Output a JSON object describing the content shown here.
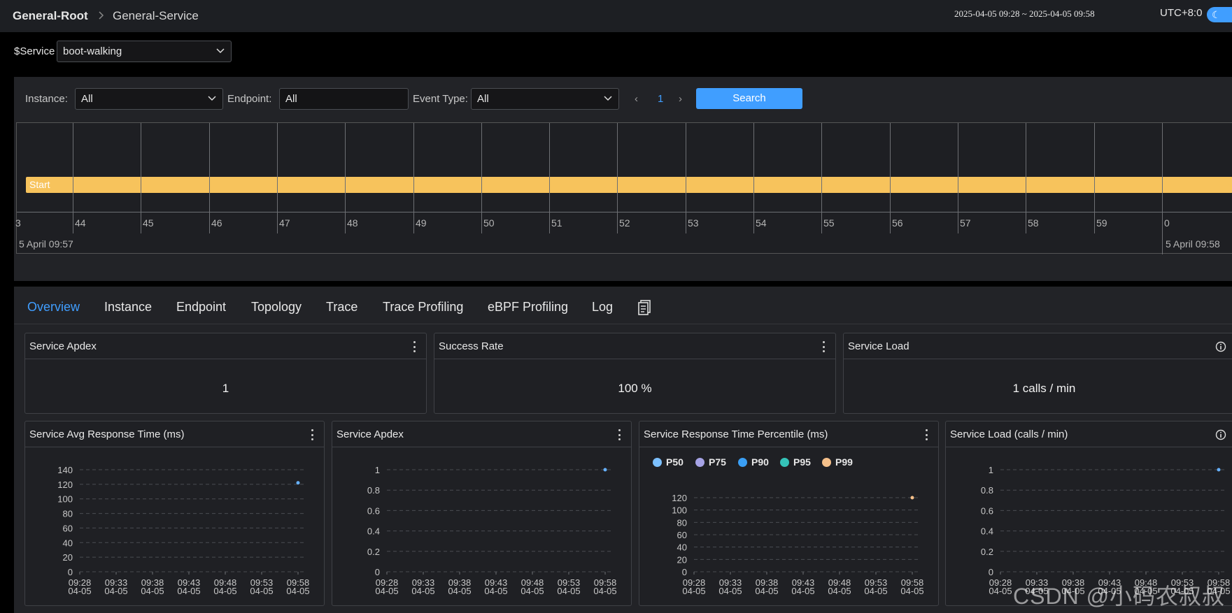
{
  "header": {
    "root_crumb": "General-Root",
    "page_crumb": "General-Service",
    "time_range": "2025-04-05 09:28 ~ 2025-04-05 09:58",
    "timezone": "UTC+8:0"
  },
  "service_selector": {
    "label": "$Service",
    "value": "boot-walking"
  },
  "events_filter": {
    "instance_label": "Instance:",
    "instance_value": "All",
    "endpoint_label": "Endpoint:",
    "endpoint_value": "All",
    "event_type_label": "Event Type:",
    "event_type_value": "All",
    "prev": "‹",
    "page": "1",
    "next": "›",
    "search_label": "Search"
  },
  "timeline": {
    "event_label": "Start",
    "first_tick_partial": "3",
    "ticks": [
      "44",
      "45",
      "46",
      "47",
      "48",
      "49",
      "50",
      "51",
      "52",
      "53",
      "54",
      "55",
      "56",
      "57",
      "58",
      "59",
      "0"
    ],
    "start_date": "5 April 09:57",
    "end_date": "5 April 09:58"
  },
  "tabs": [
    "Overview",
    "Instance",
    "Endpoint",
    "Topology",
    "Trace",
    "Trace Profiling",
    "eBPF Profiling",
    "Log"
  ],
  "active_tab": "Overview",
  "cards": [
    {
      "title": "Service Apdex",
      "value": "1"
    },
    {
      "title": "Success Rate",
      "value": "100 %"
    },
    {
      "title": "Service Load",
      "value": "1 calls / min"
    }
  ],
  "chart_data": [
    {
      "type": "line",
      "title": "Service Avg Response Time (ms)",
      "x": [
        "09:28\n04-05",
        "09:33\n04-05",
        "09:38\n04-05",
        "09:43\n04-05",
        "09:48\n04-05",
        "09:53\n04-05",
        "09:58\n04-05"
      ],
      "yticks": [
        "0",
        "20",
        "40",
        "60",
        "80",
        "100",
        "120",
        "140"
      ],
      "ylim": [
        0,
        140
      ],
      "series": [
        {
          "points": [
            [
              6,
              122
            ]
          ],
          "color": "#66b1ff"
        }
      ]
    },
    {
      "type": "line",
      "title": "Service Apdex",
      "x": [
        "09:28\n04-05",
        "09:33\n04-05",
        "09:38\n04-05",
        "09:43\n04-05",
        "09:48\n04-05",
        "09:53\n04-05",
        "09:58\n04-05"
      ],
      "yticks": [
        "0",
        "0.2",
        "0.4",
        "0.6",
        "0.8",
        "1"
      ],
      "ylim": [
        0,
        1
      ],
      "series": [
        {
          "points": [
            [
              6,
              1
            ]
          ],
          "color": "#66b1ff"
        }
      ]
    },
    {
      "type": "line",
      "title": "Service Response Time Percentile (ms)",
      "legend": [
        {
          "name": "P50",
          "color": "#7cc0ff"
        },
        {
          "name": "P75",
          "color": "#a6a3e6"
        },
        {
          "name": "P90",
          "color": "#3a9ff5"
        },
        {
          "name": "P95",
          "color": "#35c3b8"
        },
        {
          "name": "P99",
          "color": "#f5c08a"
        }
      ],
      "x": [
        "09:28\n04-05",
        "09:33\n04-05",
        "09:38\n04-05",
        "09:43\n04-05",
        "09:48\n04-05",
        "09:53\n04-05",
        "09:58\n04-05"
      ],
      "yticks": [
        "0",
        "20",
        "40",
        "60",
        "80",
        "100",
        "120"
      ],
      "ylim": [
        0,
        120
      ],
      "series": [
        {
          "name": "P99",
          "points": [
            [
              6,
              120
            ]
          ],
          "color": "#f5c08a"
        }
      ]
    },
    {
      "type": "line",
      "title": "Service Load (calls / min)",
      "x": [
        "09:28\n04-05",
        "09:33\n04-05",
        "09:38\n04-05",
        "09:43\n04-05",
        "09:48\n04-05",
        "09:53\n04-05",
        "09:58\n04-05"
      ],
      "yticks": [
        "0",
        "0.2",
        "0.4",
        "0.6",
        "0.8",
        "1"
      ],
      "ylim": [
        0,
        1
      ],
      "series": [
        {
          "points": [
            [
              6,
              1
            ]
          ],
          "color": "#66b1ff"
        }
      ]
    }
  ],
  "watermark": "CSDN @小码农叔叔",
  "icons": {
    "theme": "moon-icon",
    "menu": "more-vertical-icon",
    "info": "info-icon",
    "dropdown": "chevron-down-icon",
    "tab_extra": "document-icon"
  }
}
